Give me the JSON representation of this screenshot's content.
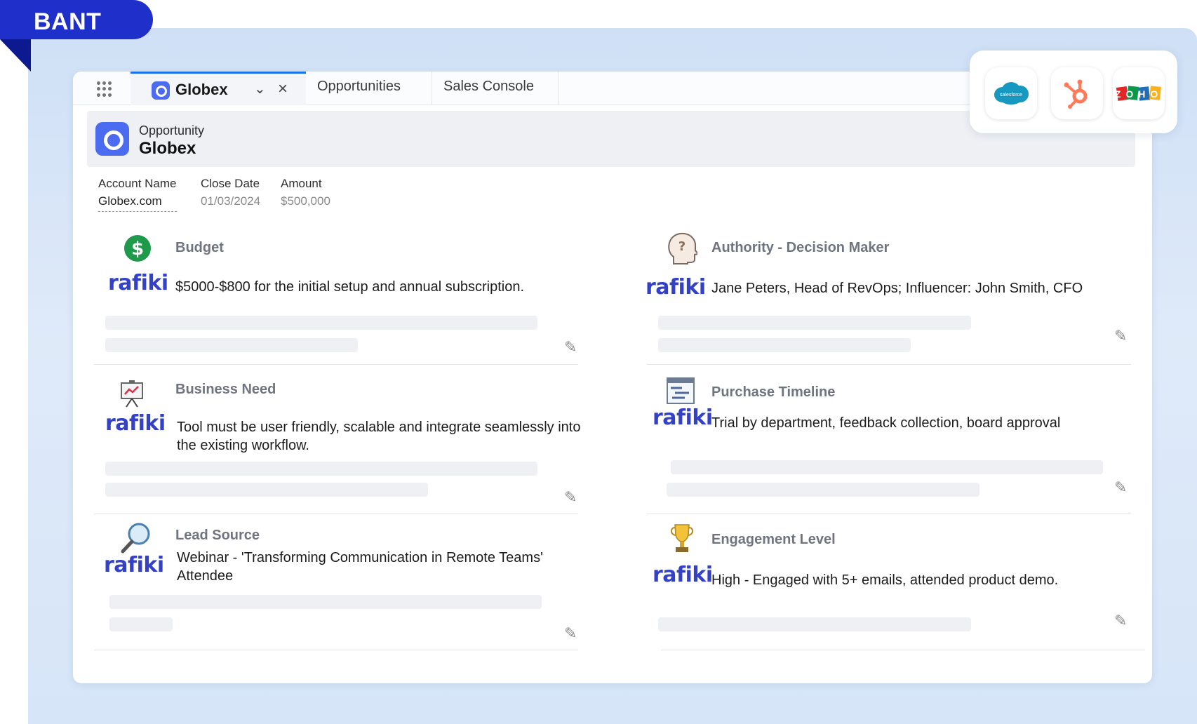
{
  "ribbon": {
    "label": "BANT"
  },
  "tabs": {
    "active": {
      "title": "Globex"
    },
    "items": [
      {
        "label": "Opportunities"
      },
      {
        "label": "Sales Console"
      }
    ]
  },
  "record": {
    "type": "Opportunity",
    "name": "Globex",
    "fields": [
      {
        "label": "Account Name",
        "value": "Globex.com"
      },
      {
        "label": "Close Date",
        "value": "01/03/2024"
      },
      {
        "label": "Amount",
        "value": "$500,000"
      }
    ]
  },
  "crm": {
    "salesforce_text": "salesforce",
    "zoho_text": "ZOHO"
  },
  "brand": {
    "rafiki": "rafiki"
  },
  "sections": {
    "budget": {
      "title": "Budget",
      "text": "$5000-$800 for the initial setup and annual subscription."
    },
    "authority": {
      "title": "Authority - Decision Maker",
      "text": "Jane Peters, Head of RevOps; Influencer: John Smith, CFO"
    },
    "need": {
      "title": "Business Need",
      "text": "Tool must be user friendly, scalable and integrate seamlessly into the existing workflow."
    },
    "timeline": {
      "title": "Purchase Timeline",
      "text": "Trial by department, feedback collection, board approval"
    },
    "lead": {
      "title": "Lead Source",
      "text": "Webinar - 'Transforming Communication in Remote Teams' Attendee"
    },
    "engagement": {
      "title": "Engagement Level",
      "text": "High - Engaged with 5+ emails, attended product demo."
    }
  },
  "colors": {
    "ribbon": "#1f2fc9",
    "rafiki": "#3340c8",
    "active_tab_border": "#1b73e8",
    "salesforce": "#1798c1",
    "hubspot": "#ff7a59"
  }
}
